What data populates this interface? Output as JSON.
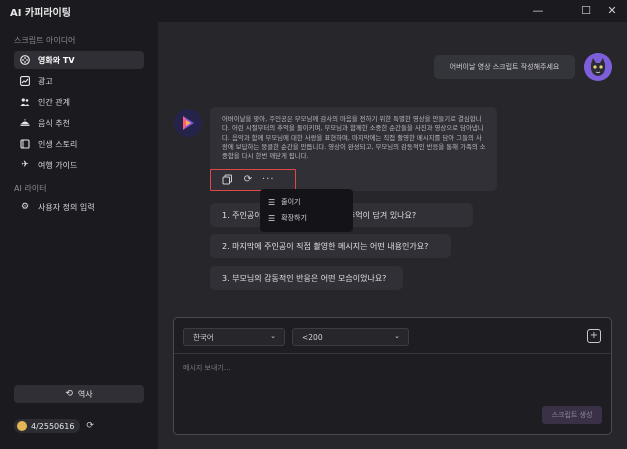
{
  "app": {
    "title": "AI 카피라이팅"
  },
  "sidebar": {
    "section_script": "스크립트 아이디어",
    "items": [
      {
        "label": "영화와 TV",
        "icon": "film-reel-icon",
        "active": true
      },
      {
        "label": "광고",
        "icon": "chart-icon",
        "active": false
      },
      {
        "label": "인간 관계",
        "icon": "people-icon",
        "active": false
      },
      {
        "label": "음식 추천",
        "icon": "food-icon",
        "active": false
      },
      {
        "label": "인생 스토리",
        "icon": "book-icon",
        "active": false
      },
      {
        "label": "여행 가이드",
        "icon": "airplane-icon",
        "active": false
      }
    ],
    "section_ai": "AI 라이터",
    "custom_input": "사용자 정의 입력",
    "history_label": "역사",
    "credits": "4/2550616"
  },
  "chat": {
    "user_message": "어버이날 영상 스크립트 작성해주세요",
    "answer": "어버이날을 맞아, 주인공은 부모님께 감사의 마음을 전하기 위한 특별한 영상을 만들기로 결심합니다. 어린 시절부터의 추억을 돌이키며, 부모님과 함께한 소중한 순간들을 사진과 영상으로 담아냅니다. 음악과 함께 부모님에 대한 사랑을 표현하며, 마지막에는 직접 촬영한 메시지를 담아 그들의 사랑에 보답하는 뭉클한 순간을 만듭니다. 영상이 완성되고, 부모님의 감동적인 반응을 통해 가족의 소중함을 다시 한번 깨닫게 됩니다.",
    "dropdown": [
      {
        "label": "줄이기",
        "icon": "shorten-icon"
      },
      {
        "label": "확장하기",
        "icon": "expand-icon"
      }
    ],
    "questions": [
      "1. 주인공이 어린 시절 사진에는 어떤 추억이 담겨 있나요?",
      "2. 마지막에 주인공이 직접 촬영한 메시지는 어떤 내용인가요?",
      "3. 부모님의 감동적인 반응은 어떤 모습이었나요?"
    ]
  },
  "composer": {
    "language": "한국어",
    "length": "<200",
    "placeholder": "메시지 보내기...",
    "generate_label": "스크립트 생성"
  },
  "colors": {
    "accent": "#7d5fd9",
    "highlight": "#e04848",
    "coin": "#e3b453"
  }
}
